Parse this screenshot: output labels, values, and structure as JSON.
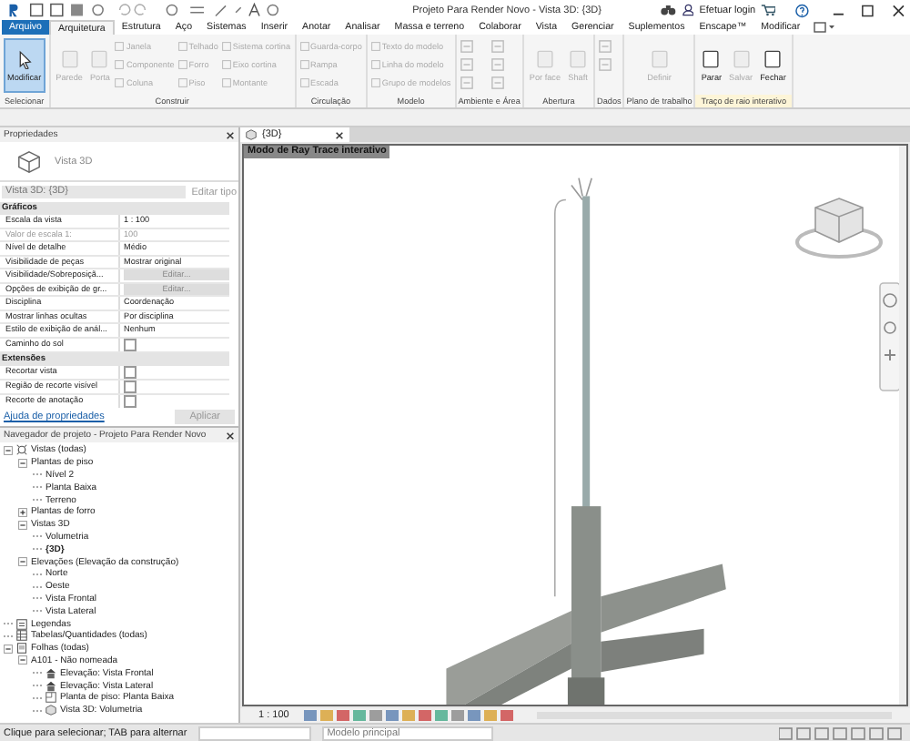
{
  "title_bar": {
    "title": "Projeto Para Render Novo - Vista 3D: {3D}",
    "login": "Efetuar login"
  },
  "ribbon_tabs": [
    {
      "label": "Arquivo",
      "kind": "file",
      "selected": false
    },
    {
      "label": "Arquitetura",
      "kind": "tab",
      "selected": true
    },
    {
      "label": "Estrutura",
      "kind": "tab",
      "selected": false
    },
    {
      "label": "Aço",
      "kind": "tab",
      "selected": false
    },
    {
      "label": "Sistemas",
      "kind": "tab",
      "selected": false
    },
    {
      "label": "Inserir",
      "kind": "tab",
      "selected": false
    },
    {
      "label": "Anotar",
      "kind": "tab",
      "selected": false
    },
    {
      "label": "Analisar",
      "kind": "tab",
      "selected": false
    },
    {
      "label": "Massa e terreno",
      "kind": "tab",
      "selected": false
    },
    {
      "label": "Colaborar",
      "kind": "tab",
      "selected": false
    },
    {
      "label": "Vista",
      "kind": "tab",
      "selected": false
    },
    {
      "label": "Gerenciar",
      "kind": "tab",
      "selected": false
    },
    {
      "label": "Suplementos",
      "kind": "tab",
      "selected": false
    },
    {
      "label": "Enscape™",
      "kind": "tab",
      "selected": false
    },
    {
      "label": "Modificar",
      "kind": "tab",
      "selected": false
    }
  ],
  "ribbon_panels": [
    {
      "label": "Selecionar",
      "highlight": false,
      "tools": [
        {
          "label": "Modificar",
          "kind": "large-active",
          "disabled": false
        }
      ]
    },
    {
      "label": "Construir",
      "highlight": false,
      "tools": [
        {
          "label": "Parede",
          "kind": "large",
          "disabled": true
        },
        {
          "label": "Porta",
          "kind": "large",
          "disabled": true
        },
        {
          "label": "Janela",
          "kind": "small",
          "disabled": true
        },
        {
          "label": "Componente",
          "kind": "small",
          "disabled": true
        },
        {
          "label": "Coluna",
          "kind": "small",
          "disabled": true
        },
        {
          "label": "Telhado",
          "kind": "small",
          "disabled": true
        },
        {
          "label": "Forro",
          "kind": "small",
          "disabled": true
        },
        {
          "label": "Piso",
          "kind": "small",
          "disabled": true
        },
        {
          "label": "Sistema cortina",
          "kind": "small",
          "disabled": true
        },
        {
          "label": "Eixo cortina",
          "kind": "small",
          "disabled": true
        },
        {
          "label": "Montante",
          "kind": "small",
          "disabled": true
        }
      ]
    },
    {
      "label": "Circulação",
      "highlight": false,
      "tools": [
        {
          "label": "Guarda-corpo",
          "kind": "small",
          "disabled": true
        },
        {
          "label": "Rampa",
          "kind": "small",
          "disabled": true
        },
        {
          "label": "Escada",
          "kind": "small",
          "disabled": true
        }
      ]
    },
    {
      "label": "Modelo",
      "highlight": false,
      "tools": [
        {
          "label": "Texto do modelo",
          "kind": "small",
          "disabled": true
        },
        {
          "label": "Linha do modelo",
          "kind": "small",
          "disabled": true
        },
        {
          "label": "Grupo de modelos",
          "kind": "small",
          "disabled": true
        }
      ]
    },
    {
      "label": "Ambiente e Área",
      "highlight": false,
      "tools": [
        {
          "kind": "icon",
          "disabled": true
        },
        {
          "kind": "icon",
          "disabled": true
        },
        {
          "kind": "icon",
          "disabled": true
        },
        {
          "kind": "icon",
          "disabled": true
        },
        {
          "kind": "icon",
          "disabled": true
        },
        {
          "kind": "icon",
          "disabled": true
        }
      ]
    },
    {
      "label": "Abertura",
      "highlight": false,
      "tools": [
        {
          "label": "Por face",
          "kind": "large",
          "disabled": true
        },
        {
          "label": "Shaft",
          "kind": "large",
          "disabled": true
        }
      ]
    },
    {
      "label": "Dados",
      "highlight": false,
      "tools": [
        {
          "kind": "icon",
          "disabled": true
        },
        {
          "kind": "icon",
          "disabled": true
        }
      ]
    },
    {
      "label": "Plano de trabalho",
      "highlight": false,
      "tools": [
        {
          "label": "Definir",
          "kind": "large",
          "disabled": true
        }
      ]
    },
    {
      "label": "Traço de raio interativo",
      "highlight": true,
      "tools": [
        {
          "label": "Parar",
          "kind": "large",
          "disabled": false
        },
        {
          "label": "Salvar",
          "kind": "large",
          "disabled": true
        },
        {
          "label": "Fechar",
          "kind": "large",
          "disabled": false
        }
      ]
    }
  ],
  "properties": {
    "title": "Propriedades",
    "type_name": "Vista 3D",
    "instance": "Vista 3D: {3D}",
    "edit_type": "Editar tipo",
    "groups": [
      {
        "label": "Gráficos",
        "rows": [
          {
            "name": "Escala da vista",
            "kind": "text",
            "value": "1 : 100",
            "disabled": false
          },
          {
            "name": "Valor de escala    1:",
            "kind": "text",
            "value": "100",
            "disabled": true
          },
          {
            "name": "Nível de detalhe",
            "kind": "text",
            "value": "Médio",
            "disabled": false
          },
          {
            "name": "Visibilidade de peças",
            "kind": "text",
            "value": "Mostrar original",
            "disabled": false
          },
          {
            "name": "Visibilidade/Sobreposiçã...",
            "kind": "button",
            "value": "Editar...",
            "disabled": false
          },
          {
            "name": "Opções de exibição de gr...",
            "kind": "button",
            "value": "Editar...",
            "disabled": false
          },
          {
            "name": "Disciplina",
            "kind": "text",
            "value": "Coordenação",
            "disabled": false
          },
          {
            "name": "Mostrar linhas ocultas",
            "kind": "text",
            "value": "Por disciplina",
            "disabled": false
          },
          {
            "name": "Estilo de exibição de anál...",
            "kind": "text",
            "value": "Nenhum",
            "disabled": false
          },
          {
            "name": "Caminho do sol",
            "kind": "checkbox",
            "checked": false,
            "disabled": false
          }
        ]
      },
      {
        "label": "Extensões",
        "rows": [
          {
            "name": "Recortar vista",
            "kind": "checkbox",
            "checked": false,
            "disabled": false
          },
          {
            "name": "Região de recorte visível",
            "kind": "checkbox",
            "checked": false,
            "disabled": false
          },
          {
            "name": "Recorte de anotação",
            "kind": "checkbox",
            "checked": false,
            "disabled": false
          }
        ]
      }
    ],
    "help_link": "Ajuda de propriedades",
    "apply": "Aplicar"
  },
  "project_browser": {
    "title": "Navegador de projeto - Projeto Para Render Novo",
    "tree": [
      {
        "label": "Vistas (todas)",
        "kind": "views",
        "expanded": true,
        "children": [
          {
            "label": "Plantas de piso",
            "expanded": true,
            "children": [
              {
                "label": "Nível 2"
              },
              {
                "label": "Planta Baixa"
              },
              {
                "label": "Terreno"
              }
            ]
          },
          {
            "label": "Plantas de forro",
            "expanded": false
          },
          {
            "label": "Vistas 3D",
            "expanded": true,
            "children": [
              {
                "label": "Volumetria"
              },
              {
                "label": "{3D}",
                "active": true
              }
            ]
          },
          {
            "label": "Elevações (Elevação da construção)",
            "expanded": true,
            "children": [
              {
                "label": "Norte"
              },
              {
                "label": "Oeste"
              },
              {
                "label": "Vista Frontal"
              },
              {
                "label": "Vista Lateral"
              }
            ]
          }
        ]
      },
      {
        "label": "Legendas",
        "kind": "legends"
      },
      {
        "label": "Tabelas/Quantidades (todas)",
        "kind": "schedules"
      },
      {
        "label": "Folhas (todas)",
        "kind": "sheets",
        "expanded": true,
        "children": [
          {
            "label": "A101 - Não nomeada",
            "expanded": true,
            "children": [
              {
                "label": "Elevação: Vista Frontal",
                "kind": "elevation"
              },
              {
                "label": "Elevação: Vista Lateral",
                "kind": "elevation"
              },
              {
                "label": "Planta de piso: Planta Baixa",
                "kind": "plan"
              },
              {
                "label": "Vista 3D: Volumetria",
                "kind": "view3d"
              }
            ]
          }
        ]
      }
    ]
  },
  "view": {
    "tab": "{3D}",
    "mode_banner": "Modo de Ray Trace interativo",
    "scale": "1 : 100"
  },
  "status_bar": {
    "hint": "Clique para selecionar; TAB para alternar",
    "model": "Modelo principal"
  }
}
